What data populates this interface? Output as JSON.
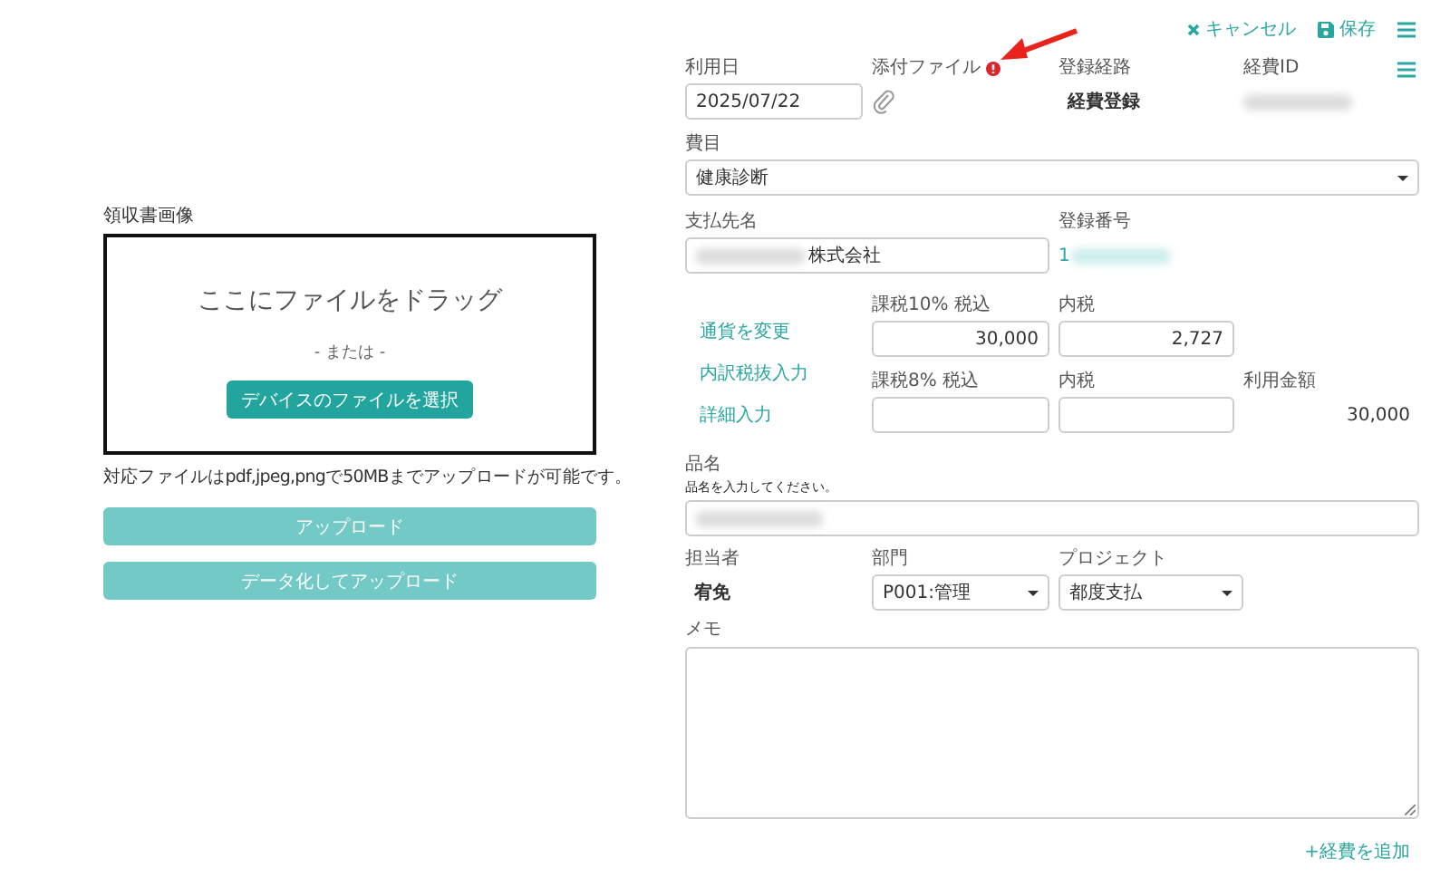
{
  "toolbar": {
    "cancel": "キャンセル",
    "save": "保存"
  },
  "upload": {
    "label": "領収書画像",
    "drop_text": "ここにファイルをドラッグ",
    "or_text": "- または -",
    "select_button": "デバイスのファイルを選択",
    "note": "対応ファイルはpdf,jpeg,pngで50MBまでアップロードが可能です。",
    "buttons": [
      "アップロード",
      "データ化してアップロード"
    ]
  },
  "form": {
    "usage_date": {
      "label": "利用日",
      "value": "2025/07/22"
    },
    "attachment": {
      "label": "添付ファイル",
      "warning": true
    },
    "route": {
      "label": "登録経路",
      "value": "経費登録"
    },
    "expense_id": {
      "label": "経費ID"
    },
    "category": {
      "label": "費目",
      "value": "健康診断"
    },
    "payee": {
      "label": "支払先名",
      "value": "株式会社"
    },
    "registration": {
      "label": "登録番号",
      "value": "1"
    },
    "links": [
      "通貨を変更",
      "内訳税抜入力",
      "詳細入力"
    ],
    "tax10": {
      "label": "課税10% 税込",
      "value": "30,000",
      "tax_label": "内税",
      "tax_value": "2,727"
    },
    "tax8": {
      "label": "課税8% 税込",
      "tax_label": "内税"
    },
    "total": {
      "label": "利用金額",
      "value": "30,000"
    },
    "item": {
      "label": "品名",
      "hint": "品名を入力してください。"
    },
    "person": {
      "label": "担当者",
      "value": "宥免"
    },
    "department": {
      "label": "部門",
      "value": "P001:管理"
    },
    "project": {
      "label": "プロジェクト",
      "value": "都度支払"
    },
    "memo": {
      "label": "メモ"
    },
    "add_link": "+経費を追加"
  }
}
